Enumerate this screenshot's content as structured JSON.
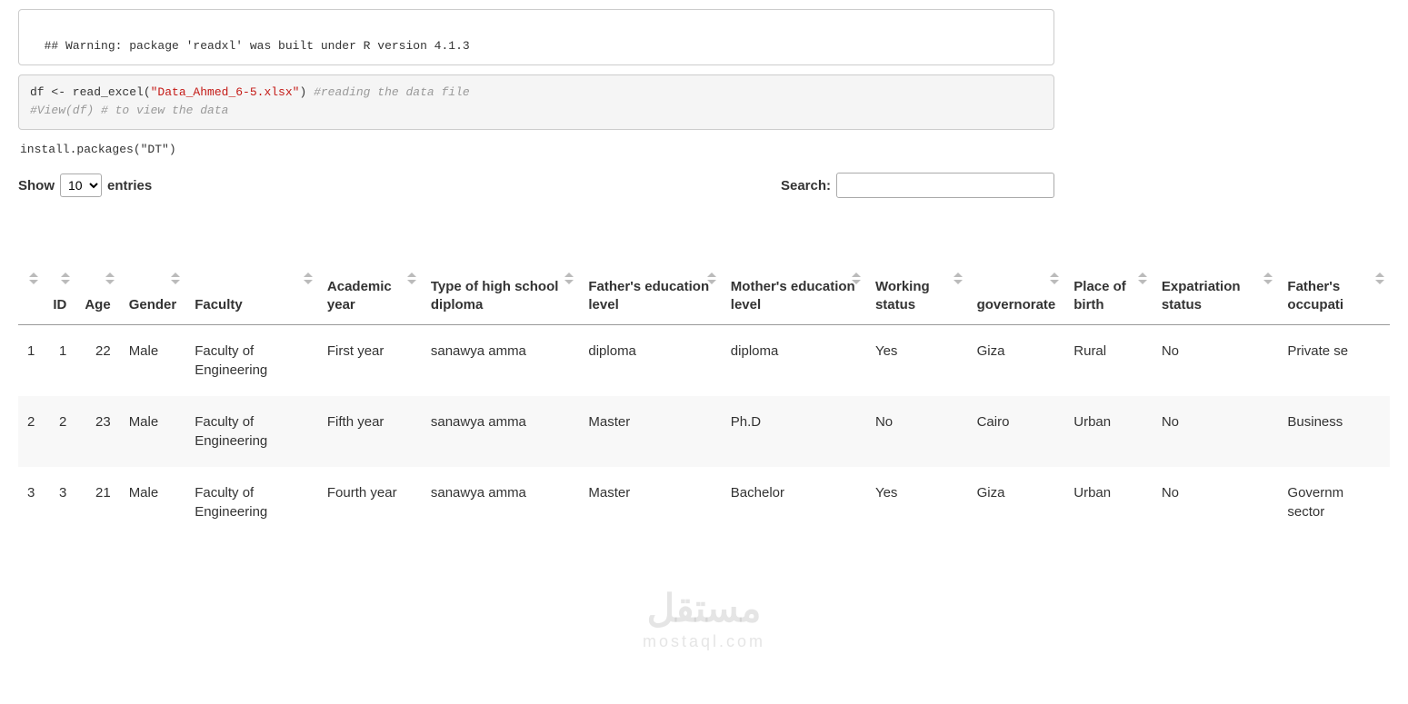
{
  "code": {
    "warning": "## Warning: package 'readxl' was built under R version 4.1.3",
    "source_pre": "df <- read_excel(",
    "source_str": "\"Data_Ahmed_6-5.xlsx\"",
    "source_post": ") ",
    "source_comment1": "#reading the data file",
    "source_comment2": "#View(df) # to view the data",
    "install": "install.packages(\"DT\")"
  },
  "dt": {
    "show_label": "Show",
    "entries_label": "entries",
    "length_value": "10",
    "search_label": "Search:",
    "search_value": ""
  },
  "table": {
    "headers": [
      "",
      "ID",
      "Age",
      "Gender",
      "Faculty",
      "Academic year",
      "Type of high school diploma",
      "Father's education level",
      "Mother's education level",
      "Working status",
      "governorate",
      "Place of birth",
      "Expatriation status",
      "Father's occupati"
    ],
    "rows": [
      [
        "1",
        "1",
        "22",
        "Male",
        "Faculty of Engineering",
        "First year",
        "sanawya amma",
        "diploma",
        "diploma",
        "Yes",
        "Giza",
        "Rural",
        "No",
        "Private se"
      ],
      [
        "2",
        "2",
        "23",
        "Male",
        "Faculty of Engineering",
        "Fifth year",
        "sanawya amma",
        "Master",
        "Ph.D",
        "No",
        "Cairo",
        "Urban",
        "No",
        "Business"
      ],
      [
        "3",
        "3",
        "21",
        "Male",
        "Faculty of Engineering",
        "Fourth year",
        "sanawya amma",
        "Master",
        "Bachelor",
        "Yes",
        "Giza",
        "Urban",
        "No",
        "Governm sector"
      ]
    ]
  },
  "watermark": {
    "main": "مستقل",
    "sub": "mostaql.com"
  }
}
